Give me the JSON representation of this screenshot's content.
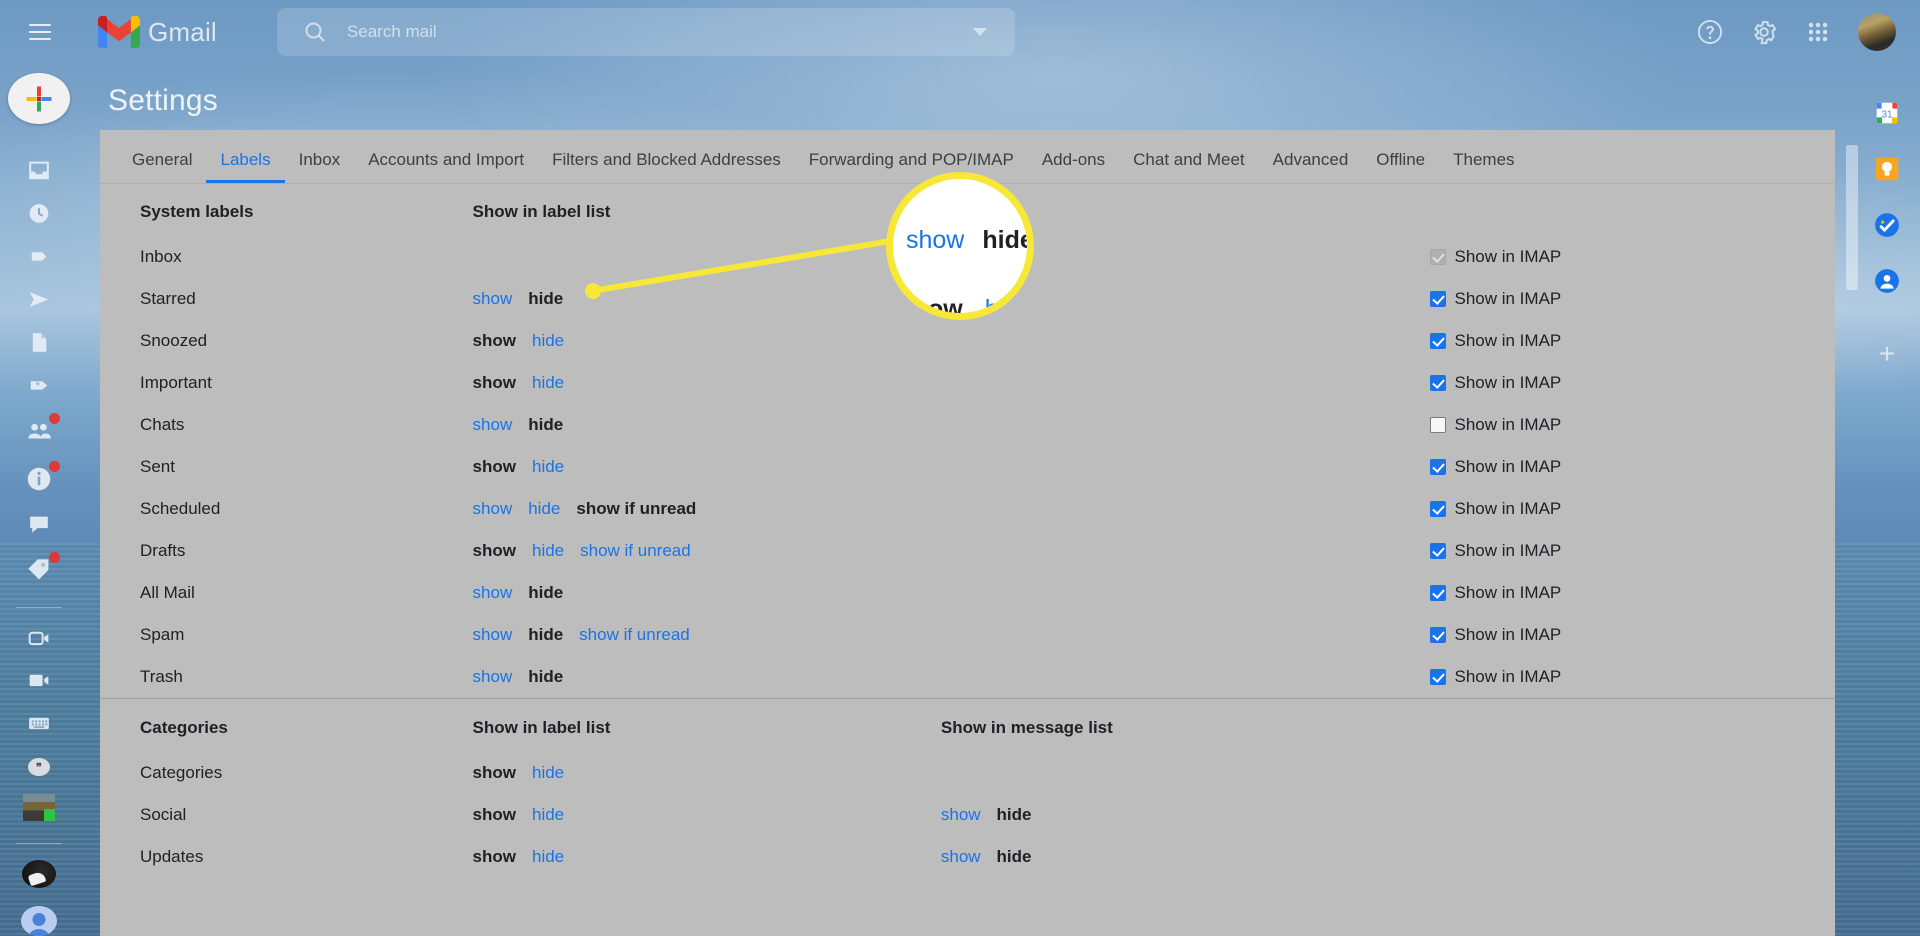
{
  "app": {
    "brand": "Gmail",
    "menu_icon": "hamburger-icon",
    "logo_icon": "gmail-logo-icon"
  },
  "search": {
    "placeholder": "Search mail",
    "value": "",
    "icon": "search-icon",
    "options_icon": "chevron-down-icon"
  },
  "topbar_actions": [
    {
      "name": "help-icon",
      "label": "Support"
    },
    {
      "name": "gear-icon",
      "label": "Settings"
    },
    {
      "name": "apps-grid-icon",
      "label": "Google apps"
    },
    {
      "name": "account-avatar",
      "label": "Google Account"
    }
  ],
  "left_rail": {
    "compose_label": "Compose",
    "items": [
      {
        "icon": "inbox-icon",
        "label": "Inbox",
        "badge": false
      },
      {
        "icon": "clock-snooze-icon",
        "label": "Snoozed",
        "badge": false
      },
      {
        "icon": "important-label-icon",
        "label": "Important",
        "badge": false
      },
      {
        "icon": "sent-arrow-icon",
        "label": "Sent",
        "badge": false
      },
      {
        "icon": "drafts-document-icon",
        "label": "Drafts",
        "badge": false
      },
      {
        "icon": "tag-icon",
        "label": "Categories",
        "badge": false
      },
      {
        "icon": "contacts-people-icon",
        "label": "Contacts",
        "badge": true
      },
      {
        "icon": "info-circle-icon",
        "label": "Info",
        "badge": true
      },
      {
        "icon": "chat-bubble-icon",
        "label": "Chat",
        "badge": false
      },
      {
        "icon": "label-tag-icon",
        "label": "Labels",
        "badge": true
      }
    ],
    "meet_items": [
      {
        "icon": "video-new-meeting-icon",
        "label": "New meeting"
      },
      {
        "icon": "video-join-icon",
        "label": "Join a meeting"
      },
      {
        "icon": "keyboard-icon",
        "label": "Keyboard"
      }
    ]
  },
  "right_rail": {
    "items": [
      {
        "icon": "google-calendar-icon",
        "label": "Calendar",
        "badge_text": "31"
      },
      {
        "icon": "google-keep-icon",
        "label": "Keep"
      },
      {
        "icon": "google-tasks-icon",
        "label": "Tasks"
      },
      {
        "icon": "google-contacts-icon",
        "label": "Contacts"
      }
    ],
    "add_label": "+"
  },
  "page_title": "Settings",
  "tabs": [
    {
      "label": "General",
      "active": false
    },
    {
      "label": "Labels",
      "active": true
    },
    {
      "label": "Inbox",
      "active": false
    },
    {
      "label": "Accounts and Import",
      "active": false
    },
    {
      "label": "Filters and Blocked Addresses",
      "active": false
    },
    {
      "label": "Forwarding and POP/IMAP",
      "active": false
    },
    {
      "label": "Add-ons",
      "active": false
    },
    {
      "label": "Chat and Meet",
      "active": false
    },
    {
      "label": "Advanced",
      "active": false
    },
    {
      "label": "Offline",
      "active": false
    },
    {
      "label": "Themes",
      "active": false
    }
  ],
  "sections": [
    {
      "id": "system-labels",
      "heading": "System labels",
      "col_label_list": "Show in label list",
      "col_message_list": "",
      "rows": [
        {
          "name": "Inbox",
          "label_list": [],
          "message_list": [],
          "imap": {
            "label": "Show in IMAP",
            "state": "disabled-checked"
          }
        },
        {
          "name": "Starred",
          "label_list": [
            {
              "text": "show",
              "state": "link"
            },
            {
              "text": "hide",
              "state": "current"
            }
          ],
          "message_list": [],
          "imap": {
            "label": "Show in IMAP",
            "state": "checked"
          }
        },
        {
          "name": "Snoozed",
          "label_list": [
            {
              "text": "show",
              "state": "current"
            },
            {
              "text": "hide",
              "state": "link"
            }
          ],
          "message_list": [],
          "imap": {
            "label": "Show in IMAP",
            "state": "checked"
          }
        },
        {
          "name": "Important",
          "label_list": [
            {
              "text": "show",
              "state": "current"
            },
            {
              "text": "hide",
              "state": "link"
            }
          ],
          "message_list": [],
          "imap": {
            "label": "Show in IMAP",
            "state": "checked"
          }
        },
        {
          "name": "Chats",
          "label_list": [
            {
              "text": "show",
              "state": "link"
            },
            {
              "text": "hide",
              "state": "current"
            }
          ],
          "message_list": [],
          "imap": {
            "label": "Show in IMAP",
            "state": "unchecked"
          }
        },
        {
          "name": "Sent",
          "label_list": [
            {
              "text": "show",
              "state": "current"
            },
            {
              "text": "hide",
              "state": "link"
            }
          ],
          "message_list": [],
          "imap": {
            "label": "Show in IMAP",
            "state": "checked"
          }
        },
        {
          "name": "Scheduled",
          "label_list": [
            {
              "text": "show",
              "state": "link"
            },
            {
              "text": "hide",
              "state": "link"
            },
            {
              "text": "show if unread",
              "state": "current"
            }
          ],
          "message_list": [],
          "imap": {
            "label": "Show in IMAP",
            "state": "checked"
          }
        },
        {
          "name": "Drafts",
          "label_list": [
            {
              "text": "show",
              "state": "current"
            },
            {
              "text": "hide",
              "state": "link"
            },
            {
              "text": "show if unread",
              "state": "link"
            }
          ],
          "message_list": [],
          "imap": {
            "label": "Show in IMAP",
            "state": "checked"
          }
        },
        {
          "name": "All Mail",
          "label_list": [
            {
              "text": "show",
              "state": "link"
            },
            {
              "text": "hide",
              "state": "current"
            }
          ],
          "message_list": [],
          "imap": {
            "label": "Show in IMAP",
            "state": "checked"
          }
        },
        {
          "name": "Spam",
          "label_list": [
            {
              "text": "show",
              "state": "link"
            },
            {
              "text": "hide",
              "state": "current"
            },
            {
              "text": "show if unread",
              "state": "link"
            }
          ],
          "message_list": [],
          "imap": {
            "label": "Show in IMAP",
            "state": "checked"
          }
        },
        {
          "name": "Trash",
          "label_list": [
            {
              "text": "show",
              "state": "link"
            },
            {
              "text": "hide",
              "state": "current"
            }
          ],
          "message_list": [],
          "imap": {
            "label": "Show in IMAP",
            "state": "checked"
          }
        }
      ]
    },
    {
      "id": "categories",
      "heading": "Categories",
      "col_label_list": "Show in label list",
      "col_message_list": "Show in message list",
      "rows": [
        {
          "name": "Categories",
          "label_list": [
            {
              "text": "show",
              "state": "current"
            },
            {
              "text": "hide",
              "state": "link"
            }
          ],
          "message_list": [],
          "imap": null
        },
        {
          "name": "Social",
          "label_list": [
            {
              "text": "show",
              "state": "current"
            },
            {
              "text": "hide",
              "state": "link"
            }
          ],
          "message_list": [
            {
              "text": "show",
              "state": "link"
            },
            {
              "text": "hide",
              "state": "current"
            }
          ],
          "imap": null
        },
        {
          "name": "Updates",
          "label_list": [
            {
              "text": "show",
              "state": "current"
            },
            {
              "text": "hide",
              "state": "link"
            }
          ],
          "message_list": [
            {
              "text": "show",
              "state": "link"
            },
            {
              "text": "hide",
              "state": "current"
            }
          ],
          "imap": null
        }
      ]
    }
  ],
  "callout": {
    "magnified_row1": [
      {
        "text": "show",
        "state": "link"
      },
      {
        "text": "hide",
        "state": "current"
      }
    ],
    "magnified_row2": [
      {
        "text": "ow",
        "state": "current"
      },
      {
        "text": "hi",
        "state": "link"
      }
    ],
    "highlight_color": "#f7e737"
  },
  "colors": {
    "accent_blue": "#1a73e8",
    "panel_bg": "#bdbdbd",
    "text_primary": "#202124",
    "highlight": "#f7e737"
  }
}
